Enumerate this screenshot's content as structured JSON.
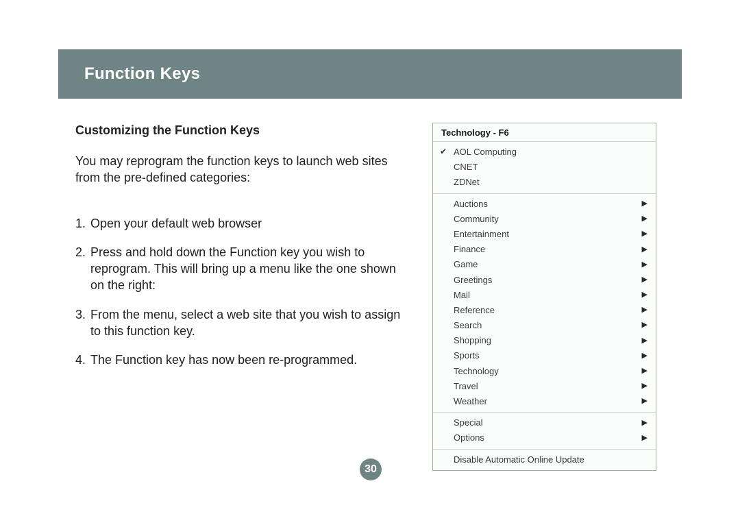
{
  "header": {
    "title": "Function Keys"
  },
  "content": {
    "subheading": "Customizing the Function Keys",
    "intro": "You may reprogram the function keys to launch web sites from the pre-defined categories:",
    "steps": [
      "Open your default web browser",
      "Press and hold down the Function key you wish to reprogram. This will bring up a menu like the one shown on the right:",
      "From the menu, select a web site that you wish to assign to this function key.",
      "The Function key has now been re-programmed."
    ]
  },
  "menu": {
    "title": "Technology - F6",
    "direct_items": [
      {
        "label": "AOL Computing",
        "checked": true
      },
      {
        "label": "CNET",
        "checked": false
      },
      {
        "label": "ZDNet",
        "checked": false
      }
    ],
    "category_items": [
      "Auctions",
      "Community",
      "Entertainment",
      "Finance",
      "Game",
      "Greetings",
      "Mail",
      "Reference",
      "Search",
      "Shopping",
      "Sports",
      "Technology",
      "Travel",
      "Weather"
    ],
    "extra_items": [
      "Special",
      "Options"
    ],
    "footer_item": "Disable Automatic Online Update"
  },
  "page_number": "30"
}
